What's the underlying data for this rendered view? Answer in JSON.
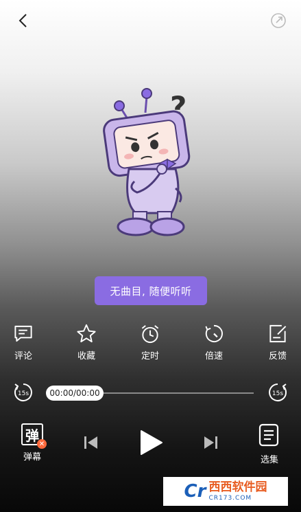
{
  "empty_state": {
    "message": "无曲目, 随便听听"
  },
  "functions": [
    {
      "label": "评论",
      "icon": "comment-icon"
    },
    {
      "label": "收藏",
      "icon": "star-icon"
    },
    {
      "label": "定时",
      "icon": "alarm-clock-icon"
    },
    {
      "label": "倍速",
      "icon": "speed-icon"
    },
    {
      "label": "反馈",
      "icon": "feedback-edit-icon"
    }
  ],
  "progress": {
    "time": "00:00/00:00",
    "rewind_label": "15s",
    "forward_label": "15s",
    "fraction": 0
  },
  "controls": {
    "danmaku_glyph": "弹",
    "danmaku_label": "弹幕",
    "episodes_label": "选集"
  },
  "watermark": {
    "text": "西西软件园",
    "sub": "CR173.COM",
    "logo": "Cr"
  },
  "colors": {
    "accent": "#8a6ce2",
    "mascot": "#c9b6ea",
    "background_top": "#ffffff",
    "background_bottom": "#080808"
  },
  "icons": {
    "back": "chevron-left-icon",
    "share": "share-icon"
  }
}
